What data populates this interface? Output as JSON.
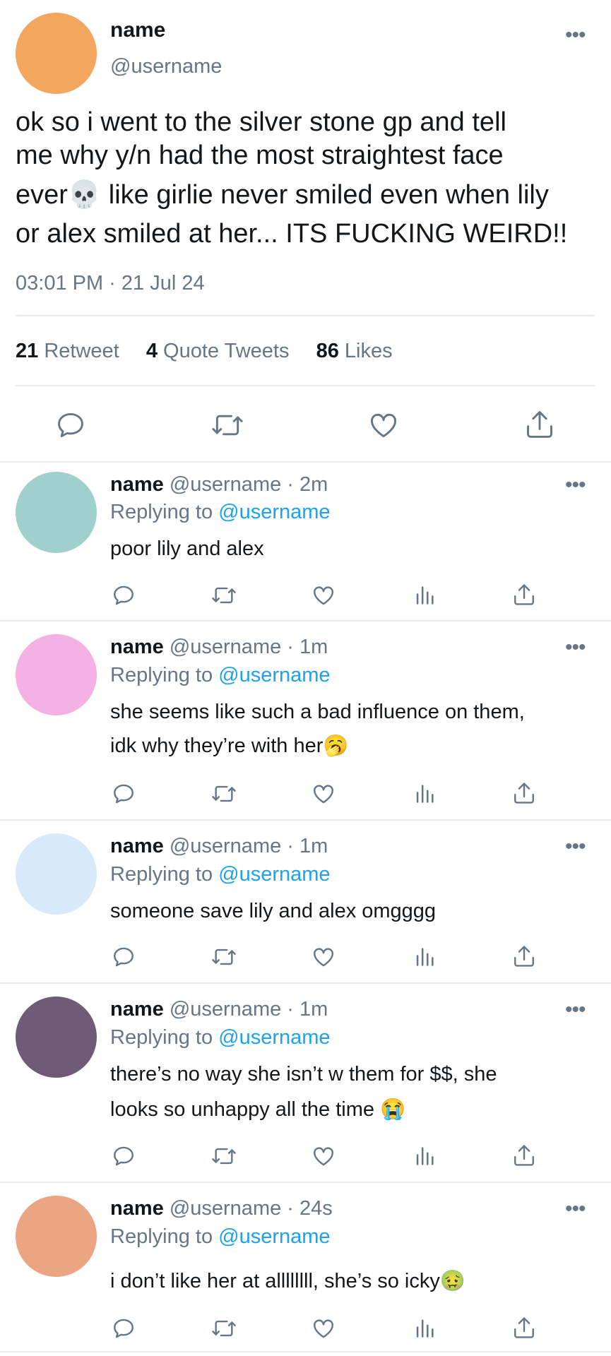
{
  "main_tweet": {
    "name": "name",
    "handle": "@username",
    "text_lines": [
      "ok so i went to the silver stone gp and tell",
      "me why y/n had the most straightest face",
      "ever💀  like girlie never smiled even when lily",
      "or alex smiled at her... ITS FUCKING WEIRD!!"
    ],
    "timestamp": "03:01 PM · 21 Jul 24",
    "stats": {
      "retweets_count": "21",
      "retweets_label": "Retweet",
      "quotes_count": "4",
      "quotes_label": "Quote Tweets",
      "likes_count": "86",
      "likes_label": "Likes"
    },
    "avatar_color": "#f2a65e"
  },
  "replying_label": "Replying to",
  "replies": [
    {
      "name": "name",
      "handle": "@username",
      "time": "· 2m",
      "replying_to": "@username",
      "lines": [
        "poor lily and alex"
      ],
      "avatar_color": "#9fd0cb"
    },
    {
      "name": "name",
      "handle": "@username",
      "time": "· 1m",
      "replying_to": "@username",
      "lines": [
        "she seems like such a bad influence on them,",
        "idk why they’re with her🥱"
      ],
      "avatar_color": "#f3b2e3"
    },
    {
      "name": "name",
      "handle": "@username",
      "time": "· 1m",
      "replying_to": "@username",
      "lines": [
        "someone save lily and alex omgggg"
      ],
      "avatar_color": "#d7e9fb"
    },
    {
      "name": "name",
      "handle": "@username",
      "time": "· 1m",
      "replying_to": "@username",
      "lines": [
        "there’s no way she isn’t w them for $$, she",
        "looks so unhappy all the time 😭"
      ],
      "avatar_color": "#6e5c76"
    },
    {
      "name": "name",
      "handle": "@username",
      "time": "· 24s",
      "replying_to": "@username",
      "lines": [
        "i don’t like her at allllllll, she’s so icky🤢"
      ],
      "avatar_color": "#eca583"
    }
  ],
  "icons": {
    "more": "more-dots-icon",
    "reply": "reply-icon",
    "retweet": "retweet-icon",
    "like": "heart-icon",
    "views": "views-icon",
    "share": "share-icon"
  },
  "colors": {
    "link": "#1da1f2",
    "muted": "#657786",
    "divider": "#e6ecf0"
  }
}
